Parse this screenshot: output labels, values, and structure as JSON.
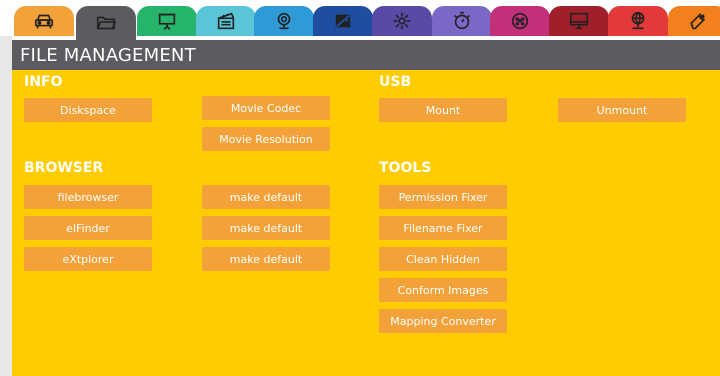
{
  "tabs": [
    {
      "icon": "car-icon",
      "color": "#f3a23a"
    },
    {
      "icon": "folder-icon",
      "color": "#5b5c5f",
      "active": true
    },
    {
      "icon": "projector-screen-icon",
      "color": "#26b36b"
    },
    {
      "icon": "clapperboard-icon",
      "color": "#5bc5d8"
    },
    {
      "icon": "webcam-icon",
      "color": "#2f9bd6"
    },
    {
      "icon": "swatch-cross-icon",
      "color": "#1f4ea0"
    },
    {
      "icon": "light-spark-icon",
      "color": "#5a4aa6"
    },
    {
      "icon": "timer-icon",
      "color": "#7a67c6"
    },
    {
      "icon": "dmx-connector-icon",
      "color": "#c2307a"
    },
    {
      "icon": "monitor-icon",
      "color": "#a01f2a"
    },
    {
      "icon": "network-globe-icon",
      "color": "#e23a3a"
    },
    {
      "icon": "wrench-icon",
      "color": "#f2811d"
    }
  ],
  "header": {
    "title": "FILE MANAGEMENT"
  },
  "sections": {
    "info": {
      "title": "INFO",
      "buttons": [
        "Diskspace",
        "Movie Codec",
        "Movie Resolution"
      ]
    },
    "usb": {
      "title": "USB",
      "buttons": [
        "Mount",
        "Unmount"
      ]
    },
    "browser": {
      "title": "BROWSER",
      "buttons": [
        "filebrowser",
        "elFinder",
        "eXtplorer"
      ],
      "default_buttons": [
        "make default",
        "make default",
        "make default"
      ]
    },
    "tools": {
      "title": "TOOLS",
      "buttons": [
        "Permission Fixer",
        "Filename Fixer",
        "Clean Hidden",
        "Conform Images",
        "Mapping Converter"
      ]
    }
  },
  "colors": {
    "main_bg": "#ffcc00",
    "button_bg": "#f3a23a",
    "header_bg": "#5b5c5f"
  }
}
